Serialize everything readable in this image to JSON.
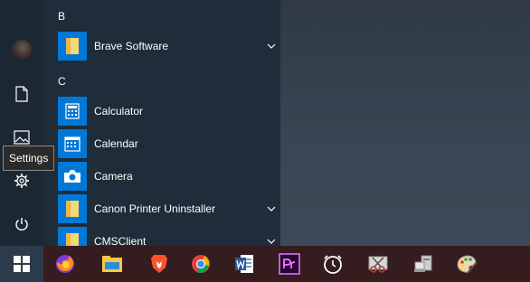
{
  "start_menu": {
    "groups": [
      {
        "letter": "B",
        "apps": [
          {
            "label": "Brave Software",
            "icon": "folder-icon",
            "expandable": true
          }
        ]
      },
      {
        "letter": "C",
        "apps": [
          {
            "label": "Calculator",
            "icon": "calculator-icon",
            "expandable": false
          },
          {
            "label": "Calendar",
            "icon": "calendar-icon",
            "expandable": false
          },
          {
            "label": "Camera",
            "icon": "camera-icon",
            "expandable": false
          },
          {
            "label": "Canon Printer Uninstaller",
            "icon": "folder-icon",
            "expandable": true
          },
          {
            "label": "CMSClient",
            "icon": "folder-icon",
            "expandable": true
          }
        ]
      }
    ],
    "rail": {
      "account": "user-avatar",
      "documents": "document-icon",
      "pictures": "pictures-icon",
      "settings": "gear-icon",
      "power": "power-icon"
    },
    "tooltip": "Settings"
  },
  "taskbar": {
    "start": "windows-logo-icon",
    "pinned": [
      "firefox-icon",
      "file-explorer-icon",
      "brave-icon",
      "chrome-icon",
      "word-icon",
      "premiere-icon",
      "alarm-clock-icon",
      "snipping-tool-icon",
      "device-manager-icon",
      "paint-icon"
    ]
  },
  "colors": {
    "tile_blue": "#0078d7",
    "menu_bg": "#1f2c39",
    "rail_bg": "#1b2733",
    "taskbar_bg": "#341c1f"
  }
}
